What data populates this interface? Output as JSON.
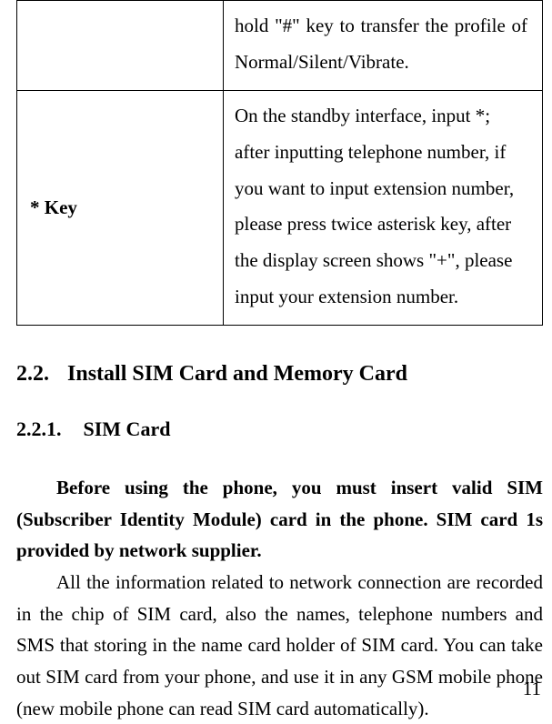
{
  "table": {
    "row0": {
      "left": "",
      "right": "hold \"#\" key to transfer the profile of Normal/Silent/Vibrate."
    },
    "row1": {
      "left": "* Key",
      "right": "On the standby interface, input *; after inputting telephone number, if you want to input extension number, please press twice asterisk key, after the display screen shows \"+\", please input your extension number."
    }
  },
  "section": {
    "number": "2.2.",
    "title": "Install SIM Card and Memory Card"
  },
  "subsection": {
    "number": "2.2.1.",
    "title": "SIM Card"
  },
  "para1": "Before using the phone, you must insert valid SIM (Subscriber Identity Module) card in the phone. SIM card 1s provided by network supplier.",
  "para2": "All the information related to network connection are recorded in the chip of SIM card, also the names, telephone numbers and SMS that storing in the name card holder of SIM card. You can take out SIM card from your phone, and use it in any GSM mobile phone (new mobile phone can read SIM card automatically).",
  "page_number": "11"
}
